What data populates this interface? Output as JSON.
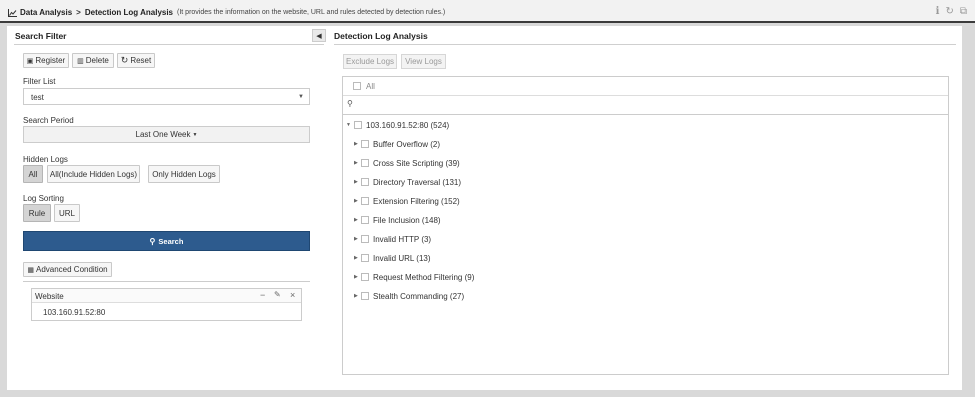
{
  "header": {
    "section": "Data Analysis",
    "separator": ">",
    "page": "Detection Log Analysis",
    "description": "(It provides the information on the website, URL and rules detected by detection rules.)",
    "icons": [
      "info-icon",
      "refresh-icon",
      "external-link-icon"
    ]
  },
  "search_filter": {
    "title": "Search Filter",
    "buttons": {
      "register": "Register",
      "delete": "Delete",
      "reset": "Reset"
    },
    "filter_list": {
      "label": "Filter List",
      "value": "test"
    },
    "search_period": {
      "label": "Search Period",
      "value": "Last One Week"
    },
    "hidden_logs": {
      "label": "Hidden Logs",
      "options": [
        "All",
        "All(Include Hidden Logs)",
        "Only Hidden Logs"
      ],
      "selected": "All"
    },
    "log_sorting": {
      "label": "Log Sorting",
      "options": [
        "Rule",
        "URL"
      ],
      "selected": "Rule"
    },
    "search_button": "Search",
    "advanced_condition": "Advanced Condition",
    "website": {
      "title": "Website",
      "value": "103.160.91.52:80"
    }
  },
  "detection_log_analysis": {
    "title": "Detection Log Analysis",
    "buttons": {
      "exclude": "Exclude Logs",
      "view": "View Logs"
    },
    "all_label": "All",
    "root": "103.160.91.52:80 (524)",
    "children": [
      "Buffer Overflow (2)",
      "Cross Site Scripting (39)",
      "Directory Traversal (131)",
      "Extension Filtering (152)",
      "File Inclusion (148)",
      "Invalid HTTP (3)",
      "Invalid URL (13)",
      "Request Method Filtering (9)",
      "Stealth Commanding (27)"
    ]
  },
  "colors": {
    "primary": "#2d5b8e",
    "header_border": "#3b3b3b"
  }
}
